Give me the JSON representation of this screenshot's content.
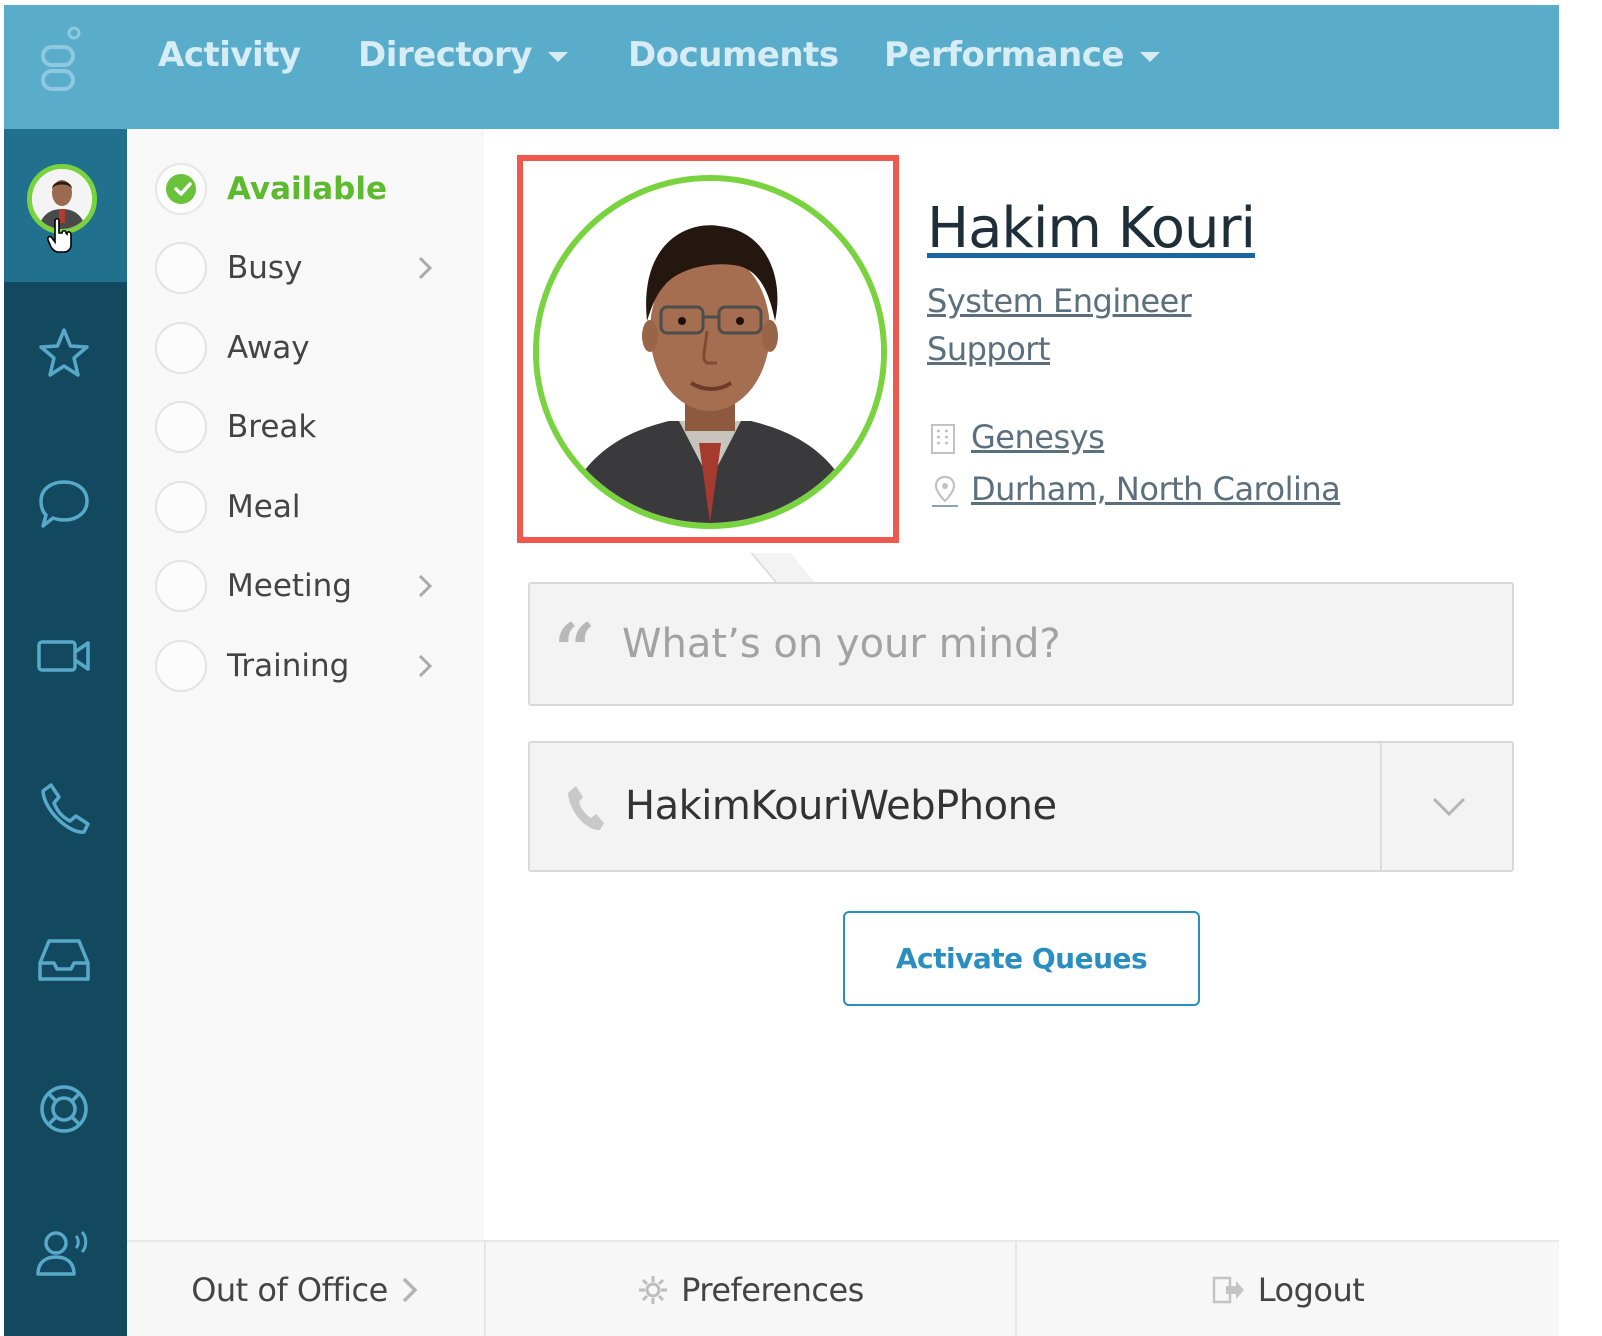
{
  "nav": {
    "items": [
      {
        "label": "Activity",
        "dropdown": false
      },
      {
        "label": "Directory",
        "dropdown": true
      },
      {
        "label": "Documents",
        "dropdown": false
      },
      {
        "label": "Performance",
        "dropdown": true
      }
    ]
  },
  "rail": {
    "icons": [
      "star-icon",
      "chat-bubble-icon",
      "video-camera-icon",
      "phone-icon",
      "inbox-icon",
      "lifebuoy-icon",
      "speaking-person-icon"
    ]
  },
  "status": {
    "items": [
      {
        "label": "Available",
        "selected": true,
        "submenu": false
      },
      {
        "label": "Busy",
        "selected": false,
        "submenu": true
      },
      {
        "label": "Away",
        "selected": false,
        "submenu": false
      },
      {
        "label": "Break",
        "selected": false,
        "submenu": false
      },
      {
        "label": "Meal",
        "selected": false,
        "submenu": false
      },
      {
        "label": "Meeting",
        "selected": false,
        "submenu": true
      },
      {
        "label": "Training",
        "selected": false,
        "submenu": true
      }
    ]
  },
  "profile": {
    "name": "Hakim Kouri",
    "title": "System Engineer",
    "department": "Support",
    "organization": "Genesys",
    "location": "Durham, North Carolina"
  },
  "mind": {
    "placeholder": "What’s on your mind?"
  },
  "phone": {
    "selected": "HakimKouriWebPhone"
  },
  "actions": {
    "activate_queues": "Activate Queues"
  },
  "footer": {
    "out_of_office": "Out of Office",
    "preferences": "Preferences",
    "logout": "Logout"
  },
  "colors": {
    "topbar": "#5aaccb",
    "rail": "#13495e",
    "rail_active": "#21708e",
    "available_green": "#6ac23a",
    "highlight_red": "#f0584d",
    "link_blue": "#2a8fc0"
  }
}
